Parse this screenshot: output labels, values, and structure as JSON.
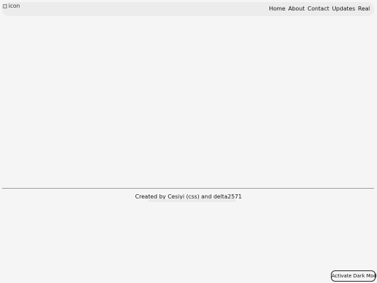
{
  "header": {
    "logo_alt": "icon",
    "nav": [
      {
        "label": "Home"
      },
      {
        "label": "About"
      },
      {
        "label": "Contact"
      },
      {
        "label": "Updates"
      },
      {
        "label": "Real"
      }
    ]
  },
  "footer": {
    "credits": "Created by Cesiyi (css) and delta2571"
  },
  "controls": {
    "dark_mode_label": "Activate Dark Mode"
  },
  "colors": {
    "background": "#f5f5f5",
    "navbar_background": "#ececec",
    "divider": "#9a9a9a"
  }
}
